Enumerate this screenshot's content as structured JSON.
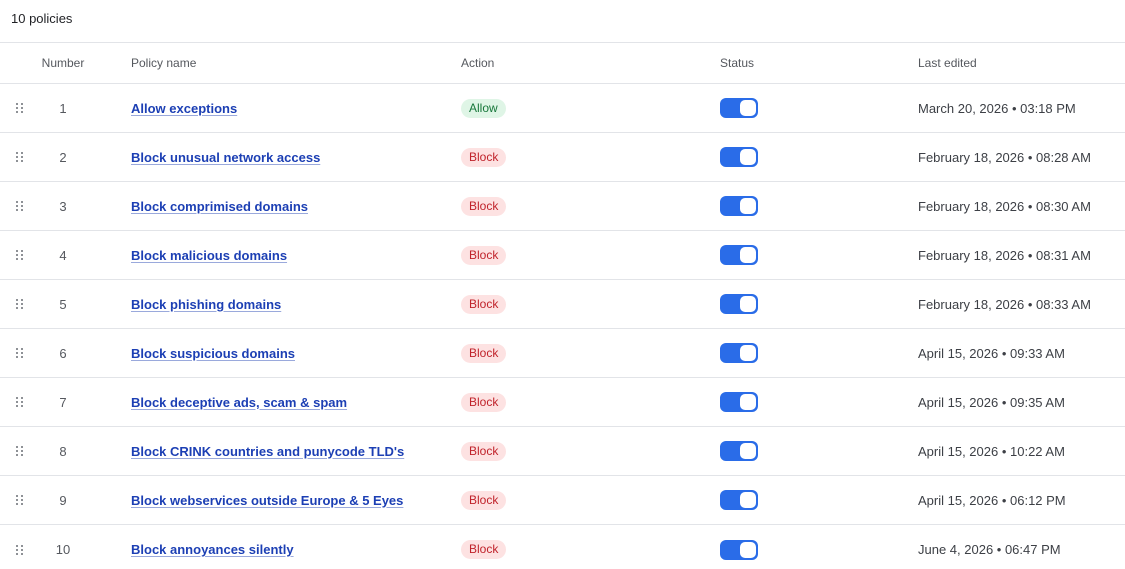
{
  "summary": {
    "policy_count": "10 policies"
  },
  "table": {
    "columns": {
      "number": "Number",
      "policy_name": "Policy name",
      "action": "Action",
      "status": "Status",
      "last_edited": "Last edited"
    },
    "rows": [
      {
        "number": "1",
        "name": "Allow exceptions",
        "action": "Allow",
        "enabled": true,
        "last_edited": "March 20, 2026 • 03:18 PM"
      },
      {
        "number": "2",
        "name": "Block unusual network access",
        "action": "Block",
        "enabled": true,
        "last_edited": "February 18, 2026 • 08:28 AM"
      },
      {
        "number": "3",
        "name": "Block comprimised domains",
        "action": "Block",
        "enabled": true,
        "last_edited": "February 18, 2026 • 08:30 AM"
      },
      {
        "number": "4",
        "name": "Block malicious domains",
        "action": "Block",
        "enabled": true,
        "last_edited": "February 18, 2026 • 08:31 AM"
      },
      {
        "number": "5",
        "name": "Block phishing domains",
        "action": "Block",
        "enabled": true,
        "last_edited": "February 18, 2026 • 08:33 AM"
      },
      {
        "number": "6",
        "name": "Block suspicious domains",
        "action": "Block",
        "enabled": true,
        "last_edited": "April 15, 2026 • 09:33 AM"
      },
      {
        "number": "7",
        "name": "Block deceptive ads, scam & spam",
        "action": "Block",
        "enabled": true,
        "last_edited": "April 15, 2026 • 09:35 AM"
      },
      {
        "number": "8",
        "name": "Block CRINK countries and punycode TLD's",
        "action": "Block",
        "enabled": true,
        "last_edited": "April 15, 2026 • 10:22 AM"
      },
      {
        "number": "9",
        "name": "Block webservices outside Europe & 5 Eyes",
        "action": "Block",
        "enabled": true,
        "last_edited": "April 15, 2026 • 06:12 PM"
      },
      {
        "number": "10",
        "name": "Block annoyances silently",
        "action": "Block",
        "enabled": true,
        "last_edited": "June 4, 2026 • 06:47 PM"
      }
    ]
  },
  "colors": {
    "link": "#1c3fb4",
    "toggle_on": "#2a6ce8",
    "allow_bg": "#dff5e6",
    "allow_text": "#17773a",
    "block_bg": "#fde2e2",
    "block_text": "#c0232b"
  },
  "icons": {
    "drag_handle": "drag-handle-icon"
  }
}
